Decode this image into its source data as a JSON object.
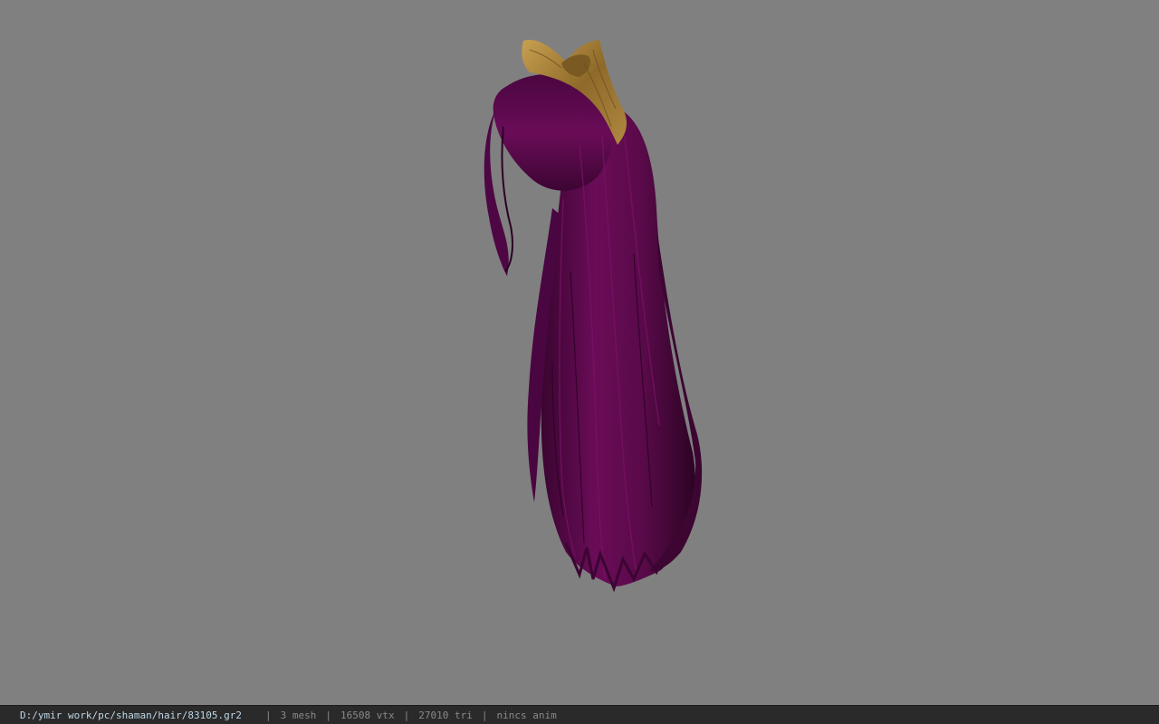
{
  "viewport": {
    "background": "#808080",
    "model": {
      "subject": "hair-model",
      "hair_color": "#5e0a4e",
      "ornament_color": "#a8843a"
    }
  },
  "statusbar": {
    "file_path": "D:/ymir work/pc/shaman/hair/83105.gr2",
    "separator": "|",
    "mesh_count": "3 mesh",
    "vertex_count": "16508 vtx",
    "triangle_count": "27010 tri",
    "anim_status": "nincs anim"
  }
}
